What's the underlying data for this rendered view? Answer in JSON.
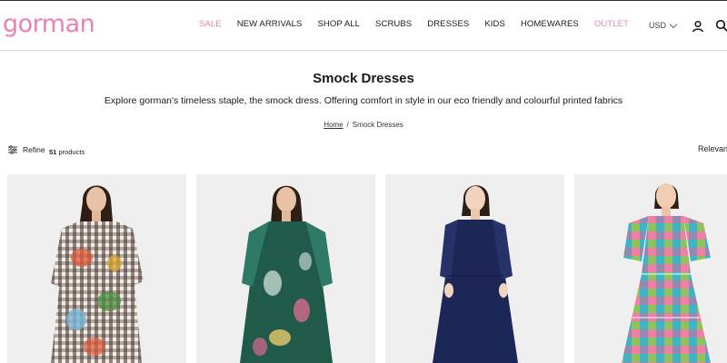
{
  "brand": {
    "logo": "gorman",
    "accent": "#e882b5"
  },
  "nav": {
    "items": [
      {
        "label": "SALE",
        "highlight": true
      },
      {
        "label": "NEW ARRIVALS",
        "highlight": false
      },
      {
        "label": "SHOP ALL",
        "highlight": false
      },
      {
        "label": "SCRUBS",
        "highlight": false
      },
      {
        "label": "DRESSES",
        "highlight": false
      },
      {
        "label": "KIDS",
        "highlight": false
      },
      {
        "label": "HOMEWARES",
        "highlight": false
      },
      {
        "label": "OUTLET",
        "highlight": true
      }
    ]
  },
  "header": {
    "currency": "USD",
    "icons": [
      "user-icon",
      "search-icon"
    ]
  },
  "page": {
    "title": "Smock Dresses",
    "description": "Explore gorman's timeless staple, the smock dress. Offering comfort in style in our eco friendly and colourful printed fabrics"
  },
  "breadcrumb": {
    "home": "Home",
    "separator": "/",
    "current": "Smock Dresses"
  },
  "toolbar": {
    "refine_label": "Refine",
    "product_count": "51",
    "product_count_suffix": "products",
    "sort_label": "Relevance"
  },
  "products": [
    {
      "image": "gingham-floral-smock-dress",
      "colors": [
        "#3d2b22",
        "#7bb5d8",
        "#e05a3a",
        "#4f8c3e",
        "#f1ede6"
      ]
    },
    {
      "image": "green-tropical-print-smock-dress",
      "colors": [
        "#1f5a4b",
        "#2f7a66",
        "#d86a8e",
        "#e8c96a",
        "#dfe9e4"
      ]
    },
    {
      "image": "navy-smock-dress",
      "colors": [
        "#1c2757",
        "#263268",
        "#f2d3bd"
      ]
    },
    {
      "image": "multicolour-check-tiered-dress",
      "colors": [
        "#3fb4c9",
        "#f07fa8",
        "#8fc25a",
        "#f4d34c",
        "#6a6bd6"
      ]
    }
  ]
}
